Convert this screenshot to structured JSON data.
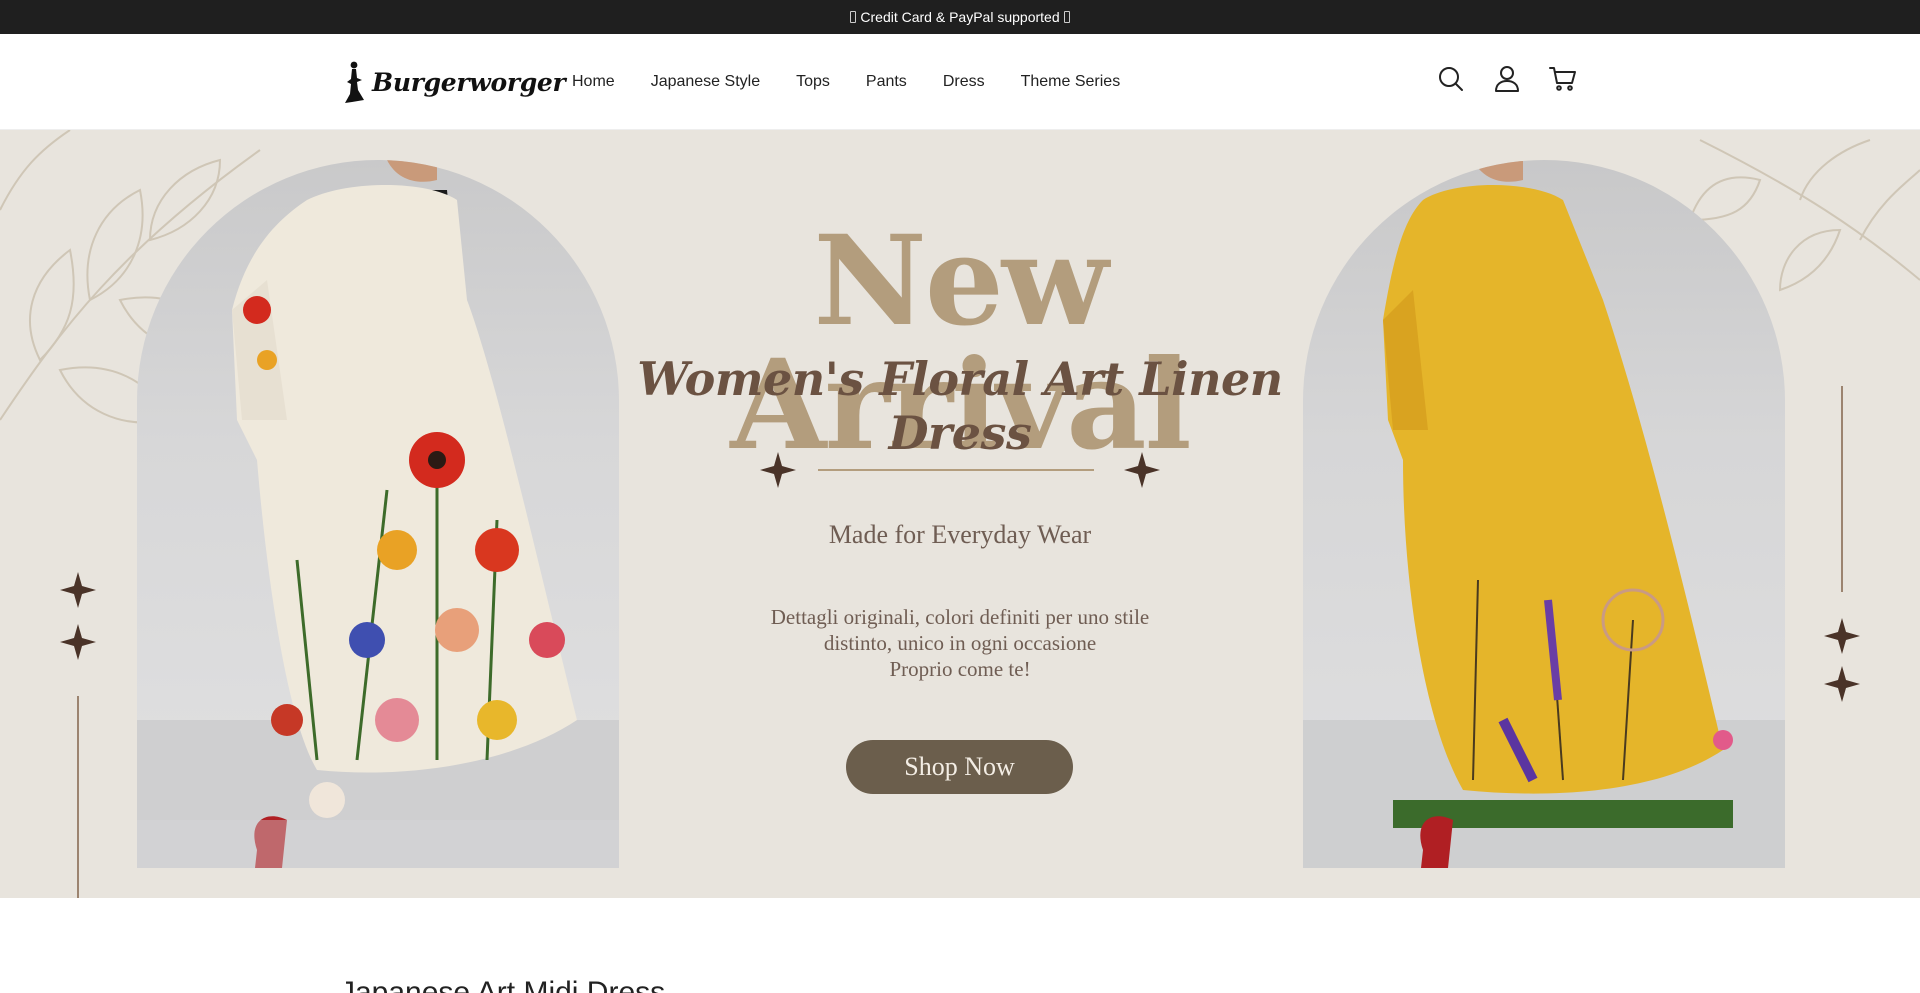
{
  "announcement": {
    "text": "Credit Card & PayPal supported"
  },
  "header": {
    "logo_text": "Burgerworger",
    "nav": [
      {
        "label": "Home"
      },
      {
        "label": "Japanese Style"
      },
      {
        "label": "Tops"
      },
      {
        "label": "Pants"
      },
      {
        "label": "Dress"
      },
      {
        "label": "Theme Series"
      }
    ],
    "icons": [
      "search-icon",
      "account-icon",
      "cart-icon"
    ]
  },
  "hero": {
    "title": "New Arrival",
    "subtitle": "Women's Floral Art Linen Dress",
    "tagline": "Made for Everyday Wear",
    "description": [
      "Dettagli originali, colori definiti per uno stile",
      "distinto, unico in ogni occasione",
      "Proprio come te!"
    ],
    "button_label": "Shop Now",
    "colors": {
      "background": "#e8e4dd",
      "title": "#b39d7d",
      "subtitle": "#6b5242",
      "button": "#6b5e4c",
      "dress_left": "#efe9dc",
      "dress_right": "#e5b52a"
    }
  },
  "section": {
    "title": "Japanese Art Midi Dress"
  }
}
